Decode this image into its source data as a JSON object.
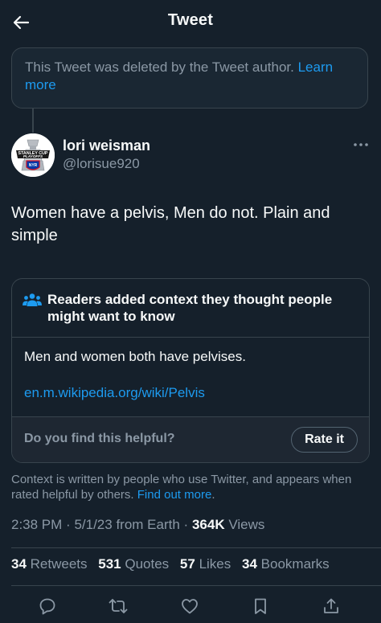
{
  "header": {
    "title": "Tweet",
    "back_icon": "arrow-left-icon"
  },
  "deleted_notice": {
    "text": "This Tweet was deleted by the Tweet author.",
    "link": "Learn more"
  },
  "author": {
    "display_name": "lori weisman",
    "handle": "@lorisue920",
    "avatar_badge_text": "STANLEY CUP PLAYOFFS",
    "more_icon": "more-horizontal-icon"
  },
  "tweet": {
    "text": "Women have a pelvis, Men do not. Plain and simple"
  },
  "note": {
    "title": "Readers added context they thought people might want to know",
    "icon": "people-icon",
    "body": "Men and women both have pelvises.",
    "link": "en.m.wikipedia.org/wiki/Pelvis",
    "helpful_question": "Do you find this helpful?",
    "rate_label": "Rate it"
  },
  "disclaimer": {
    "text": "Context is written by people who use Twitter, and appears when rated helpful by others.",
    "link": "Find out more",
    "suffix": "."
  },
  "meta": {
    "time": "2:38 PM",
    "date": "5/1/23",
    "source": "from Earth",
    "views_count": "364K",
    "views_label": "Views",
    "separator": "·"
  },
  "stats": {
    "retweets_count": "34",
    "retweets_label": "Retweets",
    "quotes_count": "531",
    "quotes_label": "Quotes",
    "likes_count": "57",
    "likes_label": "Likes",
    "bookmarks_count": "34",
    "bookmarks_label": "Bookmarks"
  },
  "actions": [
    "reply-icon",
    "retweet-icon",
    "like-icon",
    "bookmark-icon",
    "share-icon"
  ],
  "colors": {
    "background": "#15202b",
    "text_primary": "#f7f9f9",
    "text_secondary": "#8b98a5",
    "accent": "#1d9bf0",
    "border": "#38444d",
    "note_icon": "#1d9bf0"
  }
}
